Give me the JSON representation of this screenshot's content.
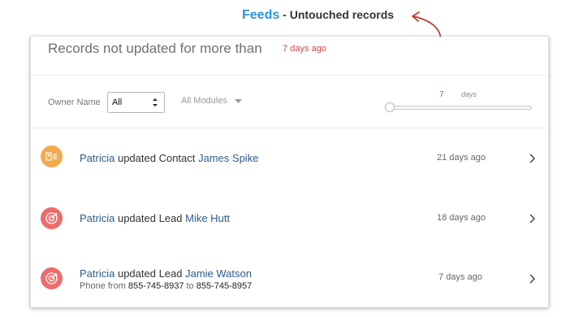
{
  "header": {
    "feeds": "Feeds",
    "separator": " - ",
    "subtitle": "Untouched records",
    "accent_color": "#2c96d8",
    "arrow_color": "#c0392b"
  },
  "panel": {
    "title": "Records not updated for more than",
    "title_value": "7 days ago"
  },
  "filters": {
    "owner_label": "Owner Name",
    "owner_value": "All",
    "modules_label": "All Modules",
    "days_value": "7",
    "days_unit": "days",
    "slider_position": 0
  },
  "feed": [
    {
      "icon": "contact-card-icon",
      "icon_color": "#f5a94c",
      "user": "Patricia",
      "action": " updated Contact ",
      "record": "James Spike",
      "time": "21 days ago"
    },
    {
      "icon": "target-icon",
      "icon_color": "#ef6b6b",
      "user": "Patricia",
      "action": " updated Lead ",
      "record": "Mike Hutt",
      "time": "18 days ago"
    },
    {
      "icon": "target-icon",
      "icon_color": "#ef6b6b",
      "user": "Patricia",
      "action": " updated Lead ",
      "record": "Jamie Watson",
      "detail": {
        "field_text": "Phone from ",
        "old_value": "855-745-8937",
        "connector": " to ",
        "new_value": "855-745-8957"
      },
      "time": "7 days ago"
    }
  ]
}
